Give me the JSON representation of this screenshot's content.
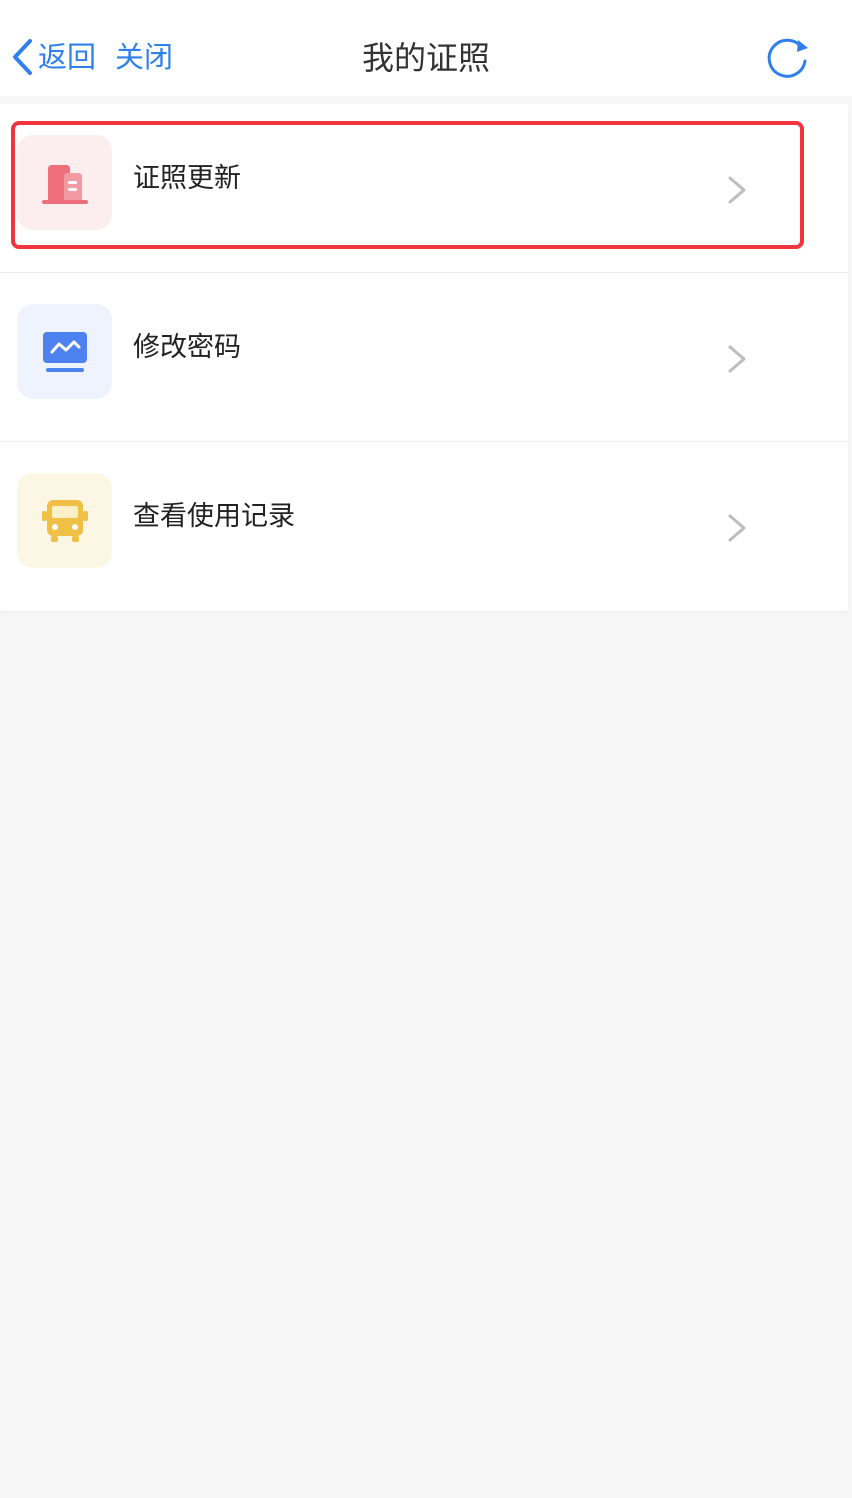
{
  "nav": {
    "back_label": "返回",
    "close_label": "关闭",
    "title": "我的证照",
    "back_icon": "chevron-left-icon",
    "refresh_icon": "refresh-icon",
    "accent_color": "#2f80ed"
  },
  "menu": {
    "items": [
      {
        "label": "证照更新",
        "icon": "building-icon",
        "icon_color": "#ee6e7c",
        "icon_bg": "#fcedef"
      },
      {
        "label": "修改密码",
        "icon": "monitor-icon",
        "icon_color": "#4e82f0",
        "icon_bg": "#eef3fd"
      },
      {
        "label": "查看使用记录",
        "icon": "bus-icon",
        "icon_color": "#f0bf45",
        "icon_bg": "#fcf6e4"
      }
    ]
  },
  "highlight": {
    "color": "#f0353f"
  }
}
